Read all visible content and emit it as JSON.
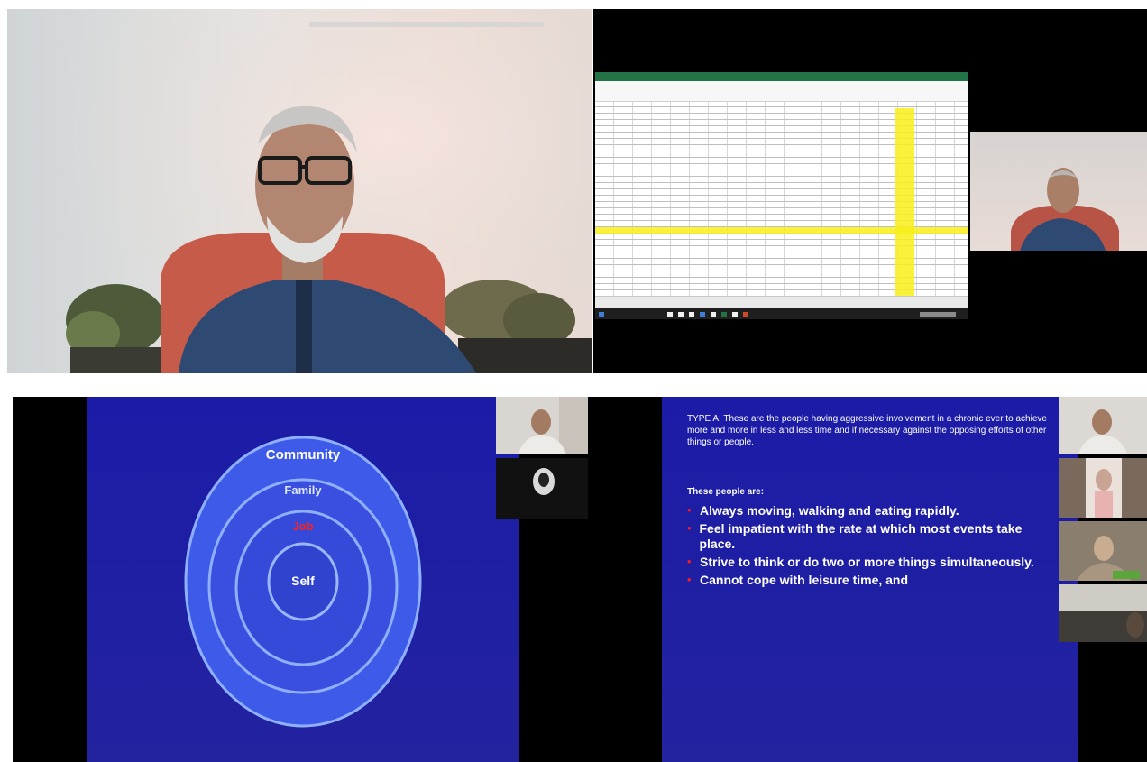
{
  "panel3": {
    "rings": [
      "Community",
      "Family",
      "Job",
      "Self"
    ],
    "ring_label_colors": [
      "#ffffff",
      "#dde6ff",
      "#ff2020",
      "#ffffff"
    ]
  },
  "panel4": {
    "type_a_paragraph": "TYPE A: These are the people having aggressive involvement in a chronic ever to achieve more and more in less and less time and if necessary against the opposing efforts of other things or people.",
    "intro": "These people are:",
    "bullets": [
      "Always moving, walking and eating rapidly.",
      "Feel impatient with the rate at which most events take place.",
      "Strive to think or do two or more things simultaneously.",
      "Cannot cope with leisure time, and"
    ]
  },
  "colors": {
    "slide_blue": "#1f1fa6",
    "highlight_yellow": "#f8ee1a",
    "excel_green": "#217346"
  }
}
